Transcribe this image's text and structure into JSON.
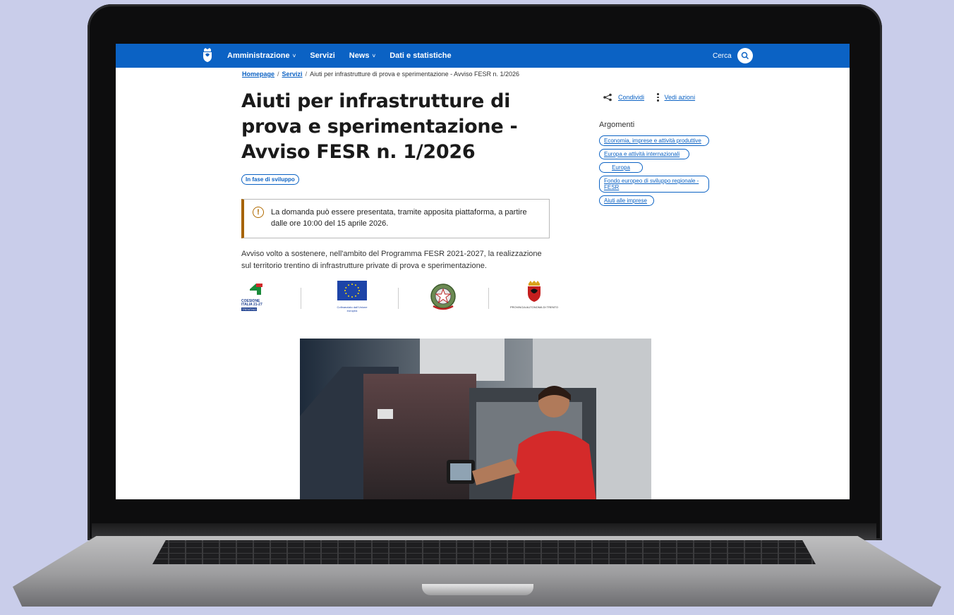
{
  "nav": {
    "items": [
      {
        "label": "Amministrazione",
        "has_dropdown": true
      },
      {
        "label": "Servizi",
        "has_dropdown": false
      },
      {
        "label": "News",
        "has_dropdown": true
      },
      {
        "label": "Dati e statistiche",
        "has_dropdown": false
      }
    ],
    "search_label": "Cerca"
  },
  "breadcrumb": {
    "home": "Homepage",
    "section": "Servizi",
    "current": "Aiuti per infrastrutture di prova e sperimentazione - Avviso FESR n. 1/2026",
    "separator": "/"
  },
  "page": {
    "title": "Aiuti per infrastrutture di prova e sperimentazione - Avviso FESR n. 1/2026",
    "status": "In fase di sviluppo",
    "callout": "La domanda può essere presentata, tramite apposita piattaforma, a partire dalle ore 10:00 del 15 aprile 2026.",
    "description": "Avviso volto a sostenere, nell'ambito del Programma FESR 2021-2027, la realizzazione sul territorio trentino di infrastrutture private di prova e sperimentazione."
  },
  "logos": {
    "coesione": "COESIONE ITALIA 21-27",
    "coesione_sub": "TRENTINO",
    "eu": "Cofinanziato dall'Unione europea",
    "provincia": "PROVINCIA AUTONOMA DI TRENTO"
  },
  "sidebar": {
    "share": "Condividi",
    "actions": "Vedi azioni",
    "topics_title": "Argomenti",
    "topics": [
      "Economia, imprese e attività produttive",
      "Europa e attività internazionali",
      "Europa",
      "Fondo europeo di sviluppo regionale - FESR",
      "Aiuti alle imprese"
    ]
  },
  "colors": {
    "brand_blue": "#0b62c4",
    "callout_accent": "#a66300",
    "background": "#c9cdea"
  }
}
